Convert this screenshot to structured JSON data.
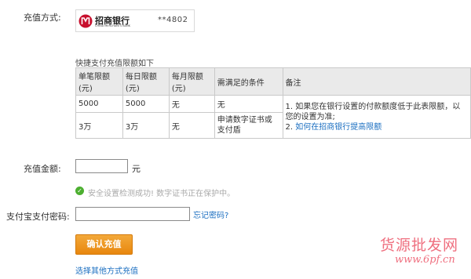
{
  "payment_method": {
    "label": "充值方式:",
    "bank_logo_text": "招商银行",
    "bank_logo_subtext": "CHINA MERCHANTS BANK",
    "card_number": "**4802"
  },
  "limits": {
    "title": "快捷支付充值限额如下",
    "headers": [
      "单笔限额(元)",
      "每日限额(元)",
      "每月限额(元)",
      "需满足的条件",
      "备注"
    ],
    "rows": [
      [
        "5000",
        "5000",
        "无",
        "无"
      ],
      [
        "3万",
        "3万",
        "无",
        "申请数字证书或支付盾"
      ]
    ],
    "note_text": "1. 如果您在银行设置的付款额度低于此表限额，以您的设置为准;",
    "note_link": "如何在招商银行提高限额",
    "note_link_prefix": "2. "
  },
  "amount": {
    "label": "充值金额:",
    "value": "",
    "unit": "元"
  },
  "security_tip": {
    "text": "安全设置检测成功! 数字证书正在保护中。"
  },
  "password": {
    "label": "支付宝支付密码:",
    "value": "",
    "forgot_link": "忘记密码?"
  },
  "confirm_button": {
    "label": "确认充值"
  },
  "other_method_link": "选择其他方式充值",
  "watermark": {
    "main": "货源批发网",
    "url": "www.6pf.cn"
  },
  "colors": {
    "link": "#1a6ec0",
    "button": "#e8870e",
    "tip_icon": "#4caf30",
    "watermark": "#ef6f7f",
    "bank_logo": "#c8102e"
  }
}
